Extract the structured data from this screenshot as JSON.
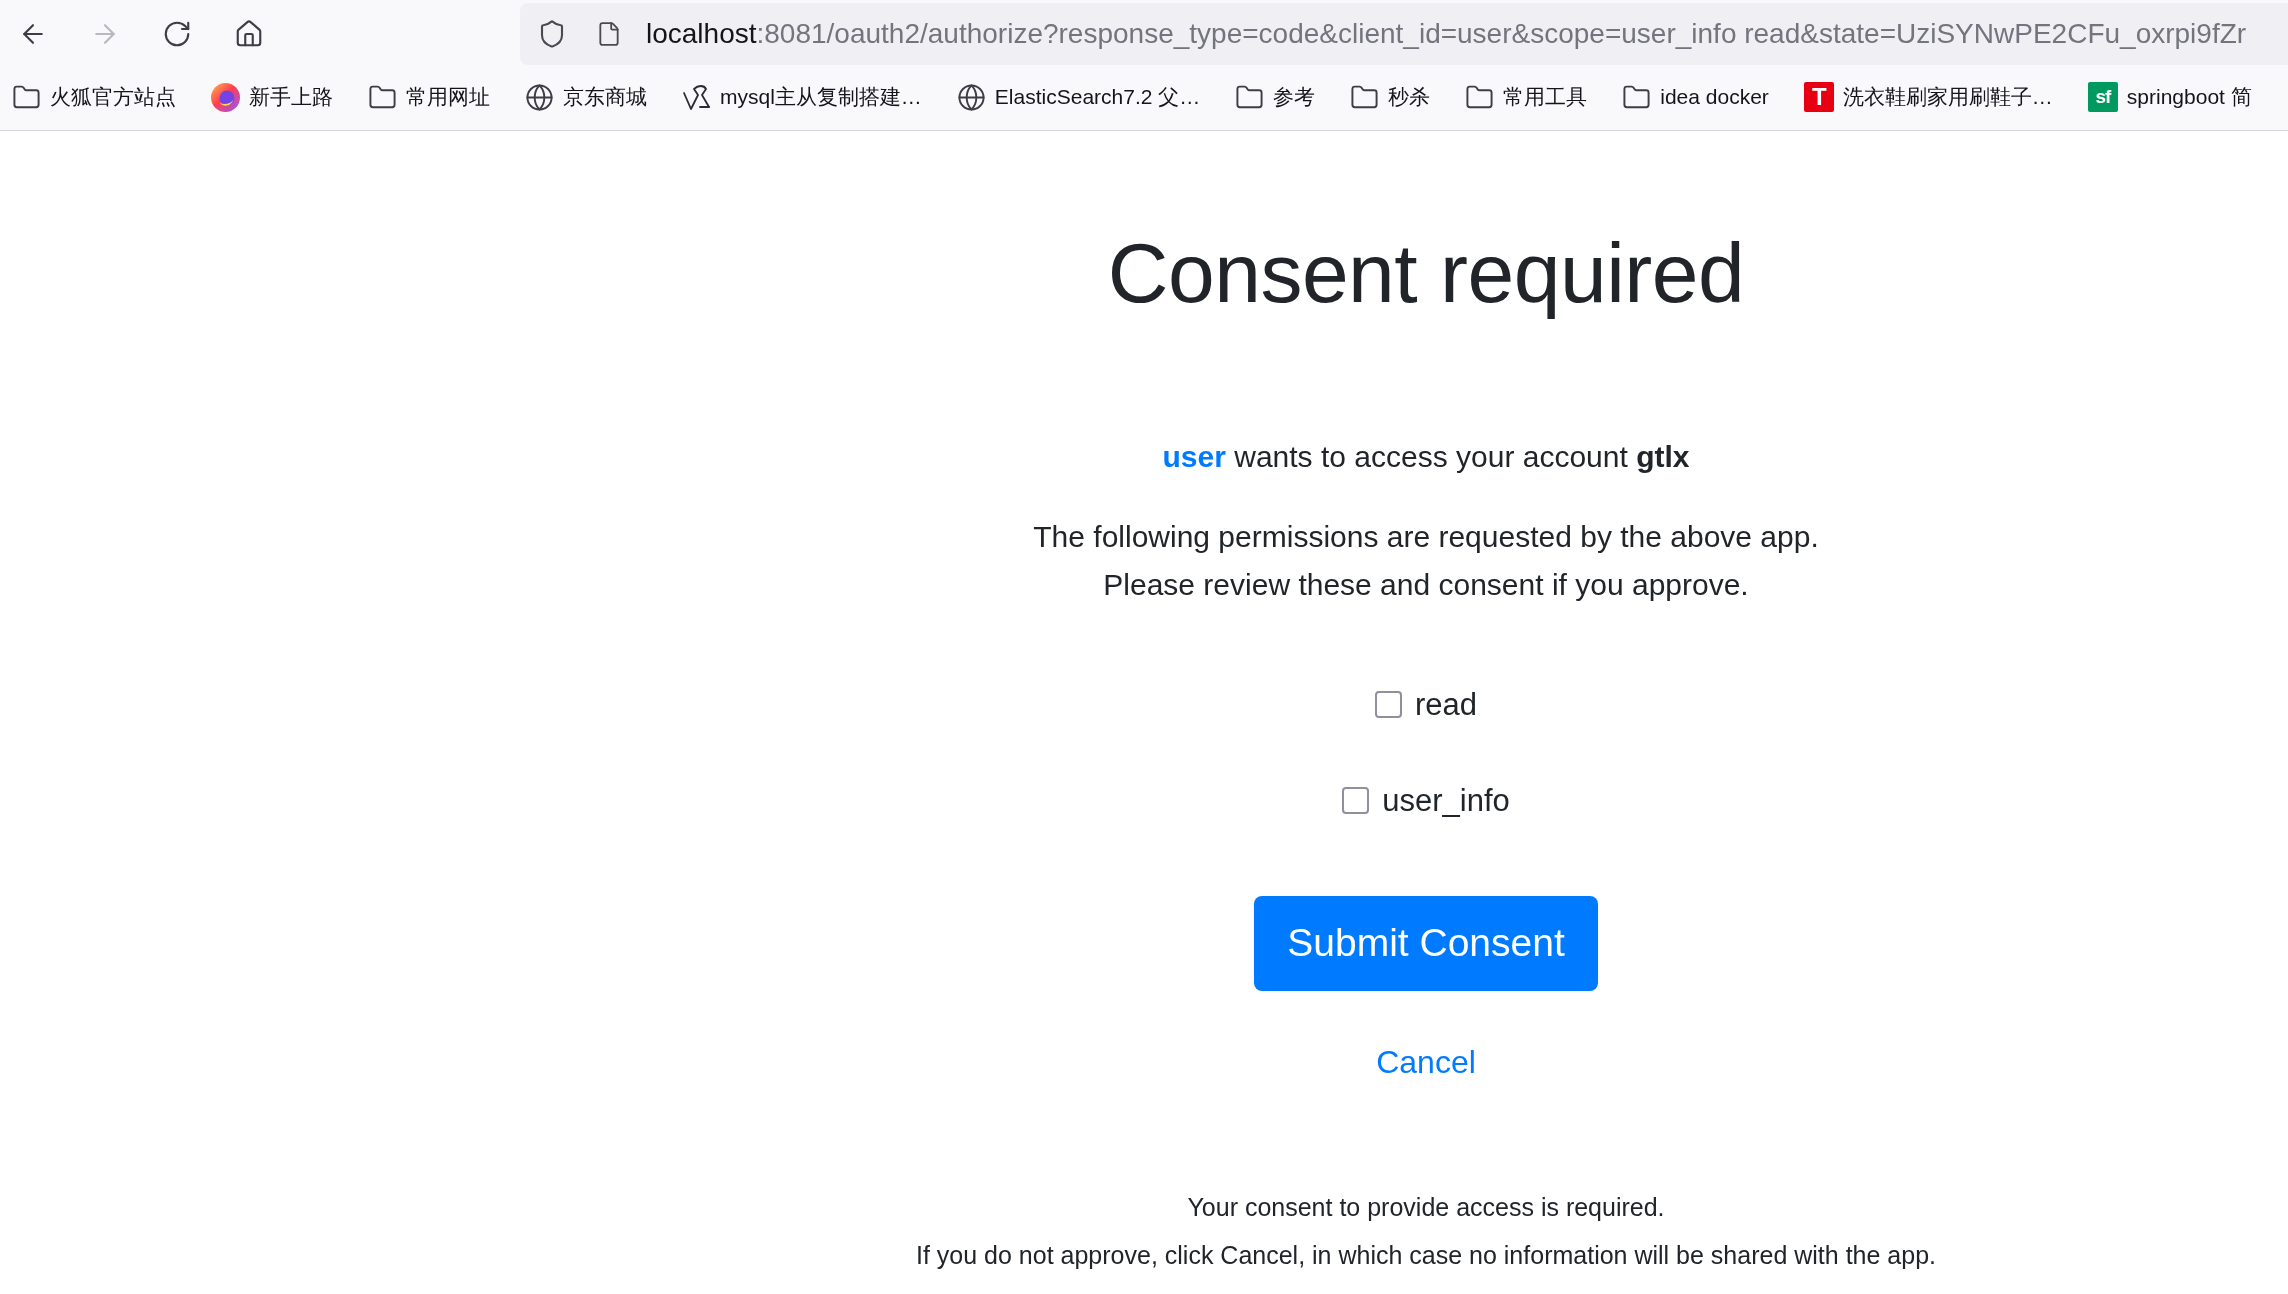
{
  "browser": {
    "nav_buttons": [
      {
        "kind": "back",
        "disabled": false
      },
      {
        "kind": "forward",
        "disabled": true
      },
      {
        "kind": "reload",
        "disabled": false
      },
      {
        "kind": "home",
        "disabled": false
      }
    ],
    "address_bar": {
      "host": "localhost",
      "path": ":8081/oauth2/authorize?response_type=code&client_id=user&scope=user_info read&state=UziSYNwPE2CFu_oxrpi9fZr"
    },
    "bookmarks": [
      {
        "kind": "folder",
        "label": "火狐官方站点"
      },
      {
        "kind": "browser",
        "label": "新手上路"
      },
      {
        "kind": "folder",
        "label": "常用网址"
      },
      {
        "kind": "globe",
        "label": "京东商城"
      },
      {
        "kind": "sketch",
        "label": "mysql主从复制搭建…"
      },
      {
        "kind": "globe",
        "label": "ElasticSearch7.2 父…"
      },
      {
        "kind": "folder",
        "label": "参考"
      },
      {
        "kind": "folder",
        "label": "秒杀"
      },
      {
        "kind": "folder",
        "label": "常用工具"
      },
      {
        "kind": "folder",
        "label": "idea docker"
      },
      {
        "kind": "tile",
        "logo_text": "T",
        "color": "#e60012",
        "label": "洗衣鞋刷家用刷鞋子…"
      },
      {
        "kind": "tile",
        "logo_text": "sf",
        "color": "#009a61",
        "label": "springboot 简"
      }
    ]
  },
  "page": {
    "title": "Consent required",
    "request": {
      "client": "user",
      "message": "wants to access your account",
      "account": "gtlx"
    },
    "permissions_note": [
      "The following permissions are requested by the above app.",
      "Please review these and consent if you approve."
    ],
    "scopes": [
      {
        "label": "read",
        "checked": false
      },
      {
        "label": "user_info",
        "checked": false
      }
    ],
    "submit_button": "Submit Consent",
    "cancel_button": "Cancel",
    "footer_note": [
      "Your consent to provide access is required.",
      "If you do not approve, click Cancel, in which case no information will be shared with the app."
    ]
  }
}
